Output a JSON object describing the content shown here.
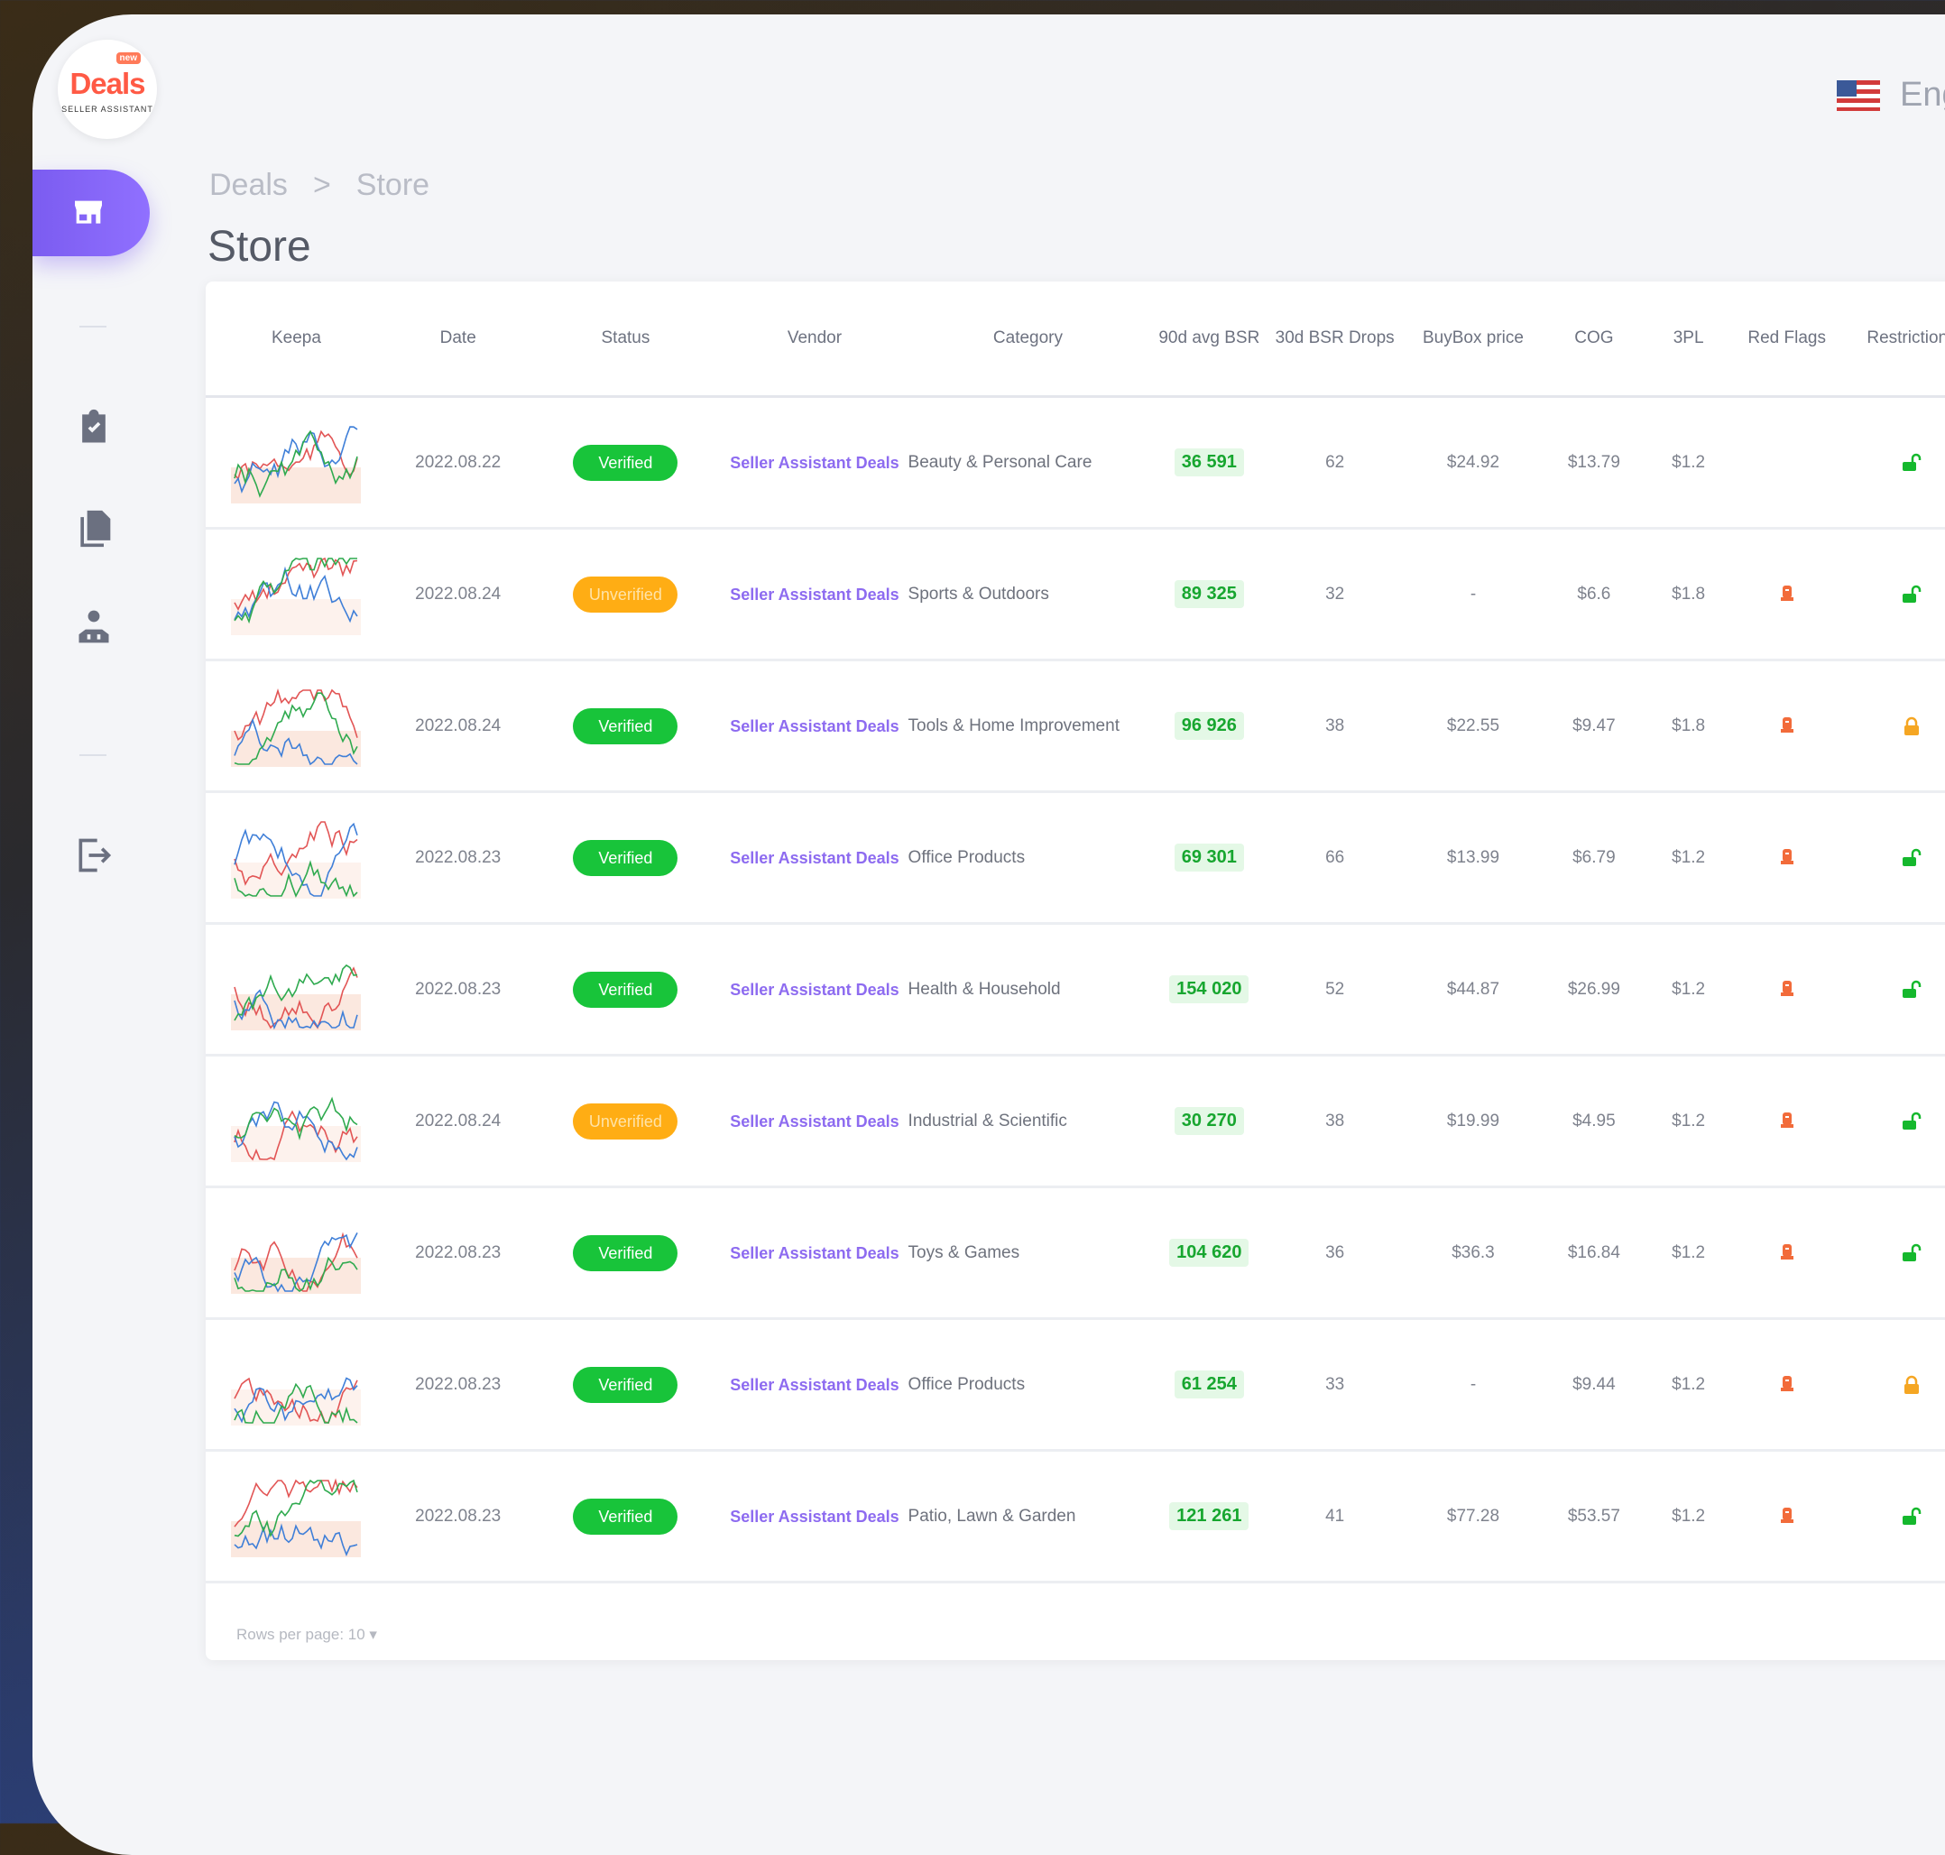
{
  "logo": {
    "badge": "new",
    "word": "Deals",
    "sub": "SELLER ASSISTANT"
  },
  "breadcrumb": {
    "root": "Deals",
    "separator": ">",
    "current": "Store"
  },
  "page_title": "Store",
  "language": {
    "label": "Eng"
  },
  "nav_icons": [
    "store-icon",
    "task-check-icon",
    "documents-icon",
    "users-icon",
    "logout-icon"
  ],
  "table": {
    "headers": [
      "Keepa",
      "Date",
      "Status",
      "Vendor",
      "Category",
      "90d avg BSR",
      "30d BSR Drops",
      "BuyBox price",
      "COG",
      "3PL",
      "Red Flags",
      "Restrictions"
    ],
    "rows": [
      {
        "date": "2022.08.22",
        "status": "Verified",
        "vendor": "Seller Assistant Deals",
        "category": "Beauty & Personal Care",
        "bsr": "36 591",
        "drops": "62",
        "buybox": "$24.92",
        "cog": "$13.79",
        "tpl": "$1.2",
        "red_flag": false,
        "restricted": false
      },
      {
        "date": "2022.08.24",
        "status": "Unverified",
        "vendor": "Seller Assistant Deals",
        "category": "Sports & Outdoors",
        "bsr": "89 325",
        "drops": "32",
        "buybox": "-",
        "cog": "$6.6",
        "tpl": "$1.8",
        "red_flag": true,
        "restricted": false
      },
      {
        "date": "2022.08.24",
        "status": "Verified",
        "vendor": "Seller Assistant Deals",
        "category": "Tools & Home Improvement",
        "bsr": "96 926",
        "drops": "38",
        "buybox": "$22.55",
        "cog": "$9.47",
        "tpl": "$1.8",
        "red_flag": true,
        "restricted": true
      },
      {
        "date": "2022.08.23",
        "status": "Verified",
        "vendor": "Seller Assistant Deals",
        "category": "Office Products",
        "bsr": "69 301",
        "drops": "66",
        "buybox": "$13.99",
        "cog": "$6.79",
        "tpl": "$1.2",
        "red_flag": true,
        "restricted": false
      },
      {
        "date": "2022.08.23",
        "status": "Verified",
        "vendor": "Seller Assistant Deals",
        "category": "Health & Household",
        "bsr": "154 020",
        "drops": "52",
        "buybox": "$44.87",
        "cog": "$26.99",
        "tpl": "$1.2",
        "red_flag": true,
        "restricted": false
      },
      {
        "date": "2022.08.24",
        "status": "Unverified",
        "vendor": "Seller Assistant Deals",
        "category": "Industrial & Scientific",
        "bsr": "30 270",
        "drops": "38",
        "buybox": "$19.99",
        "cog": "$4.95",
        "tpl": "$1.2",
        "red_flag": true,
        "restricted": false
      },
      {
        "date": "2022.08.23",
        "status": "Verified",
        "vendor": "Seller Assistant Deals",
        "category": "Toys & Games",
        "bsr": "104 620",
        "drops": "36",
        "buybox": "$36.3",
        "cog": "$16.84",
        "tpl": "$1.2",
        "red_flag": true,
        "restricted": false
      },
      {
        "date": "2022.08.23",
        "status": "Verified",
        "vendor": "Seller Assistant Deals",
        "category": "Office Products",
        "bsr": "61 254",
        "drops": "33",
        "buybox": "-",
        "cog": "$9.44",
        "tpl": "$1.2",
        "red_flag": true,
        "restricted": true
      },
      {
        "date": "2022.08.23",
        "status": "Verified",
        "vendor": "Seller Assistant Deals",
        "category": "Patio, Lawn & Garden",
        "bsr": "121 261",
        "drops": "41",
        "buybox": "$77.28",
        "cog": "$53.57",
        "tpl": "$1.2",
        "red_flag": true,
        "restricted": false
      }
    ]
  },
  "pagination": {
    "rows_per_page": "Rows per page: 10 ▾"
  },
  "colors": {
    "accent": "#8a66f5",
    "verified": "#18c43a",
    "unverified": "#ffad14",
    "bsr_text": "#17a62f",
    "red_flag": "#f26b3a",
    "unlock": "#15b82d",
    "lock": "#f5a623"
  }
}
